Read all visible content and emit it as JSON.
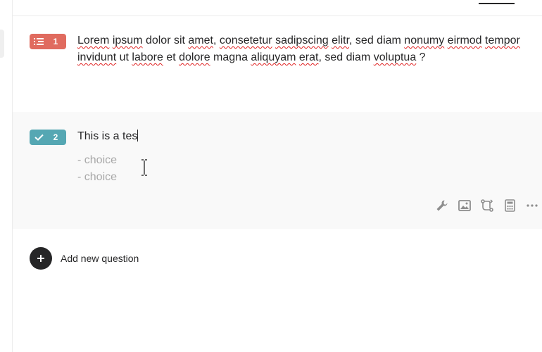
{
  "questions": [
    {
      "number": "1",
      "type_icon": "list-icon",
      "badge_color": "#e06b5f",
      "text_parts": [
        {
          "t": "Lorem",
          "err": true
        },
        {
          "t": " ",
          "err": false
        },
        {
          "t": "ipsum",
          "err": true
        },
        {
          "t": " dolor sit ",
          "err": false
        },
        {
          "t": "amet",
          "err": true
        },
        {
          "t": ", ",
          "err": false
        },
        {
          "t": "consetetur",
          "err": true
        },
        {
          "t": " ",
          "err": false
        },
        {
          "t": "sadipscing",
          "err": true
        },
        {
          "t": " ",
          "err": false
        },
        {
          "t": "elitr",
          "err": true
        },
        {
          "t": ", sed diam ",
          "err": false
        },
        {
          "t": "nonumy",
          "err": true
        },
        {
          "t": " ",
          "err": false
        },
        {
          "t": "eirmod",
          "err": true
        },
        {
          "t": " ",
          "err": false
        },
        {
          "t": "tempor",
          "err": true
        },
        {
          "t": " ",
          "err": false
        },
        {
          "t": "invidunt",
          "err": true
        },
        {
          "t": " ut ",
          "err": false
        },
        {
          "t": "labore",
          "err": true
        },
        {
          "t": " et ",
          "err": false
        },
        {
          "t": "dolore",
          "err": true
        },
        {
          "t": " magna ",
          "err": false
        },
        {
          "t": "aliquyam",
          "err": true
        },
        {
          "t": " ",
          "err": false
        },
        {
          "t": "erat",
          "err": true
        },
        {
          "t": ", sed diam ",
          "err": false
        },
        {
          "t": "voluptua",
          "err": true
        },
        {
          "t": " ?",
          "err": false
        }
      ]
    },
    {
      "number": "2",
      "type_icon": "checkmark-icon",
      "badge_color": "#55a7b3",
      "text": "This is a tes",
      "choice_placeholders": [
        "- choice",
        "- choice"
      ],
      "toolbar": [
        "wrench-icon",
        "image-icon",
        "branch-icon",
        "calculator-icon",
        "more-icon"
      ]
    }
  ],
  "add_question_label": "Add new question"
}
